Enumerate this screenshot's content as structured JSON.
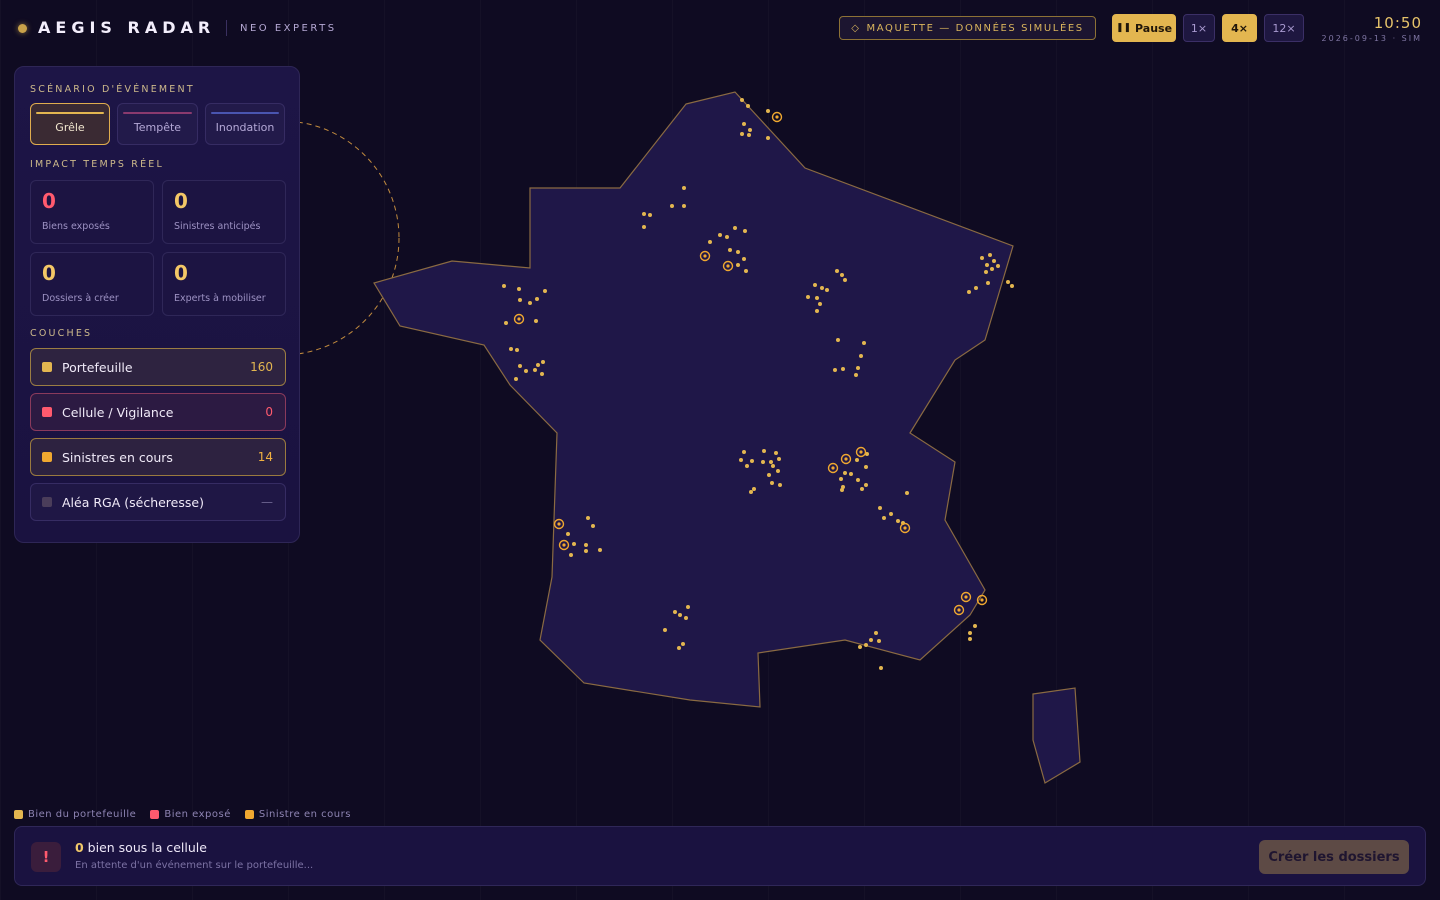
{
  "header": {
    "brand": "AEGIS RADAR",
    "subtitle": "NEO EXPERTS",
    "mock_badge": "MAQUETTE — DONNÉES SIMULÉES",
    "mock_badge_icon": "diamond-icon",
    "pause_label": "Pause",
    "speeds": [
      "1×",
      "4×",
      "12×"
    ],
    "active_speed": "4×",
    "time": "10:50",
    "date": "2026-09-13 · SIM"
  },
  "panel": {
    "scenario_title": "SCÉNARIO D'ÉVÉNEMENT",
    "scenarios": [
      {
        "label": "Grêle",
        "color": "#e3b650",
        "active": true
      },
      {
        "label": "Tempête",
        "color": "#8a3a6e",
        "active": false
      },
      {
        "label": "Inondation",
        "color": "#4a55b0",
        "active": false
      }
    ],
    "impact_title": "IMPACT TEMPS RÉEL",
    "kpis": [
      {
        "value": "0",
        "label": "Biens exposés",
        "color": "#ff5a6e"
      },
      {
        "value": "0",
        "label": "Sinistres anticipés",
        "color": "#f3c766"
      },
      {
        "value": "0",
        "label": "Dossiers à créer",
        "color": "#f3c766"
      },
      {
        "value": "0",
        "label": "Experts à mobiliser",
        "color": "#f3c766"
      }
    ],
    "layers_title": "COUCHES",
    "layers": [
      {
        "label": "Portefeuille",
        "count": "160",
        "color": "#e3b650",
        "count_color": "#e3b650"
      },
      {
        "label": "Cellule / Vigilance",
        "count": "0",
        "color": "#ff5a6e",
        "count_color": "#ff5a6e"
      },
      {
        "label": "Sinistres en cours",
        "count": "14",
        "color": "#f0a830",
        "count_color": "#f0b040"
      },
      {
        "label": "Aléa RGA (sécheresse)",
        "count": "—",
        "color": "#4a3d5a",
        "count_color": "#6e6590"
      }
    ]
  },
  "legend": [
    {
      "label": "Bien du portefeuille",
      "color": "#e3b650"
    },
    {
      "label": "Bien exposé",
      "color": "#ff5a6e"
    },
    {
      "label": "Sinistre en cours",
      "color": "#f0a830"
    }
  ],
  "bottom": {
    "icon": "!",
    "count": "0",
    "title_rest": " bien sous la cellule",
    "subtitle": "En attente d'un événement sur le portefeuille...",
    "create_label": "Créer les dossiers"
  },
  "colors": {
    "accent": "#e3b650",
    "danger": "#ff5a6e",
    "map_fill": "#1f1748",
    "map_stroke": "#8a6a42"
  }
}
